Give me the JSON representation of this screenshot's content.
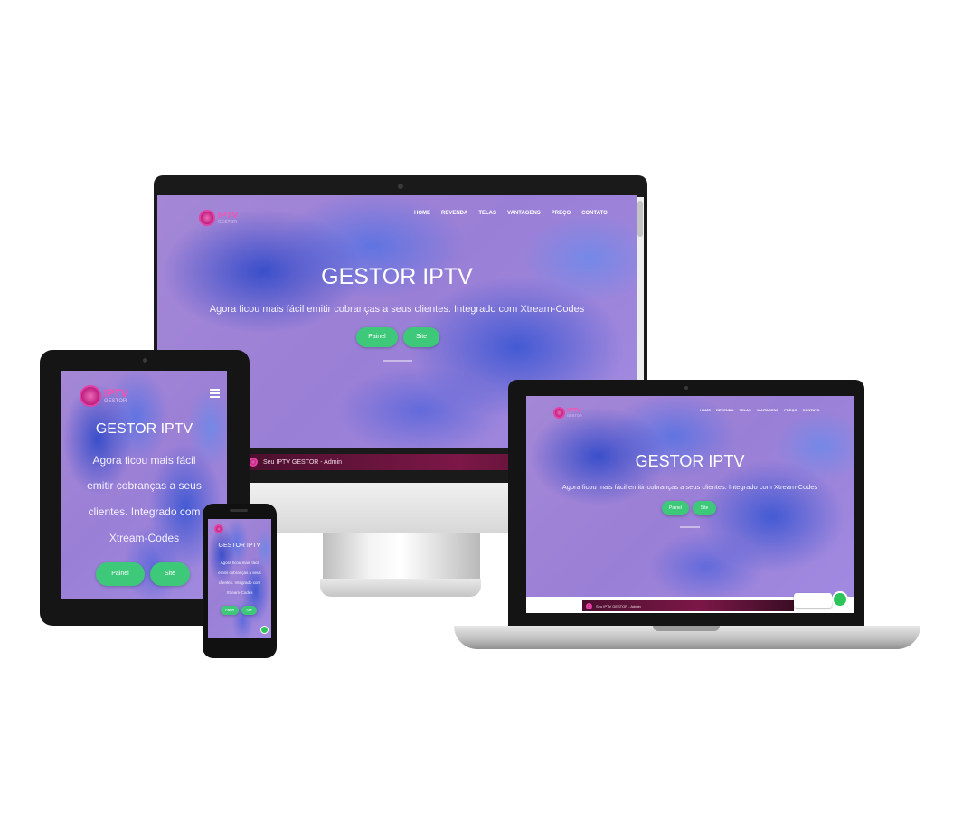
{
  "site": {
    "title": "GESTOR IPTV",
    "subtitle": "Agora ficou mais fácil emitir cobranças a seus clientes. Integrado com Xtream-Codes",
    "nav": [
      "HOME",
      "REVENDA",
      "TELAS",
      "VANTAGENS",
      "PREÇO",
      "CONTATO"
    ],
    "buttons": {
      "panel": "Painel",
      "site": "Site"
    },
    "logo": {
      "text": "IPTV",
      "sub": "GESTOR"
    },
    "bar_label": "Seu IPTV GESTOR - Admin"
  },
  "tablet": {
    "subtitle_lines": [
      "Agora ficou mais fácil",
      "emitir cobranças a seus",
      "clientes. Integrado com",
      "Xtream-Codes"
    ]
  },
  "phone": {
    "title": "GESTOR IPTV",
    "subtitle_lines": [
      "Agora ficou mais fácil",
      "emitir cobranças a seus",
      "clientes. Integrado com",
      "Xtream-Codes"
    ]
  },
  "colors": {
    "accent_green": "#3ec97a",
    "logo_pink": "#e43fa3",
    "hero_purple": "#9a7fd6",
    "bar_maroon": "#7c1747"
  },
  "icons": {
    "menu": "hamburger-icon",
    "chat": "whatsapp-icon",
    "logo": "iptv-logo-icon"
  }
}
